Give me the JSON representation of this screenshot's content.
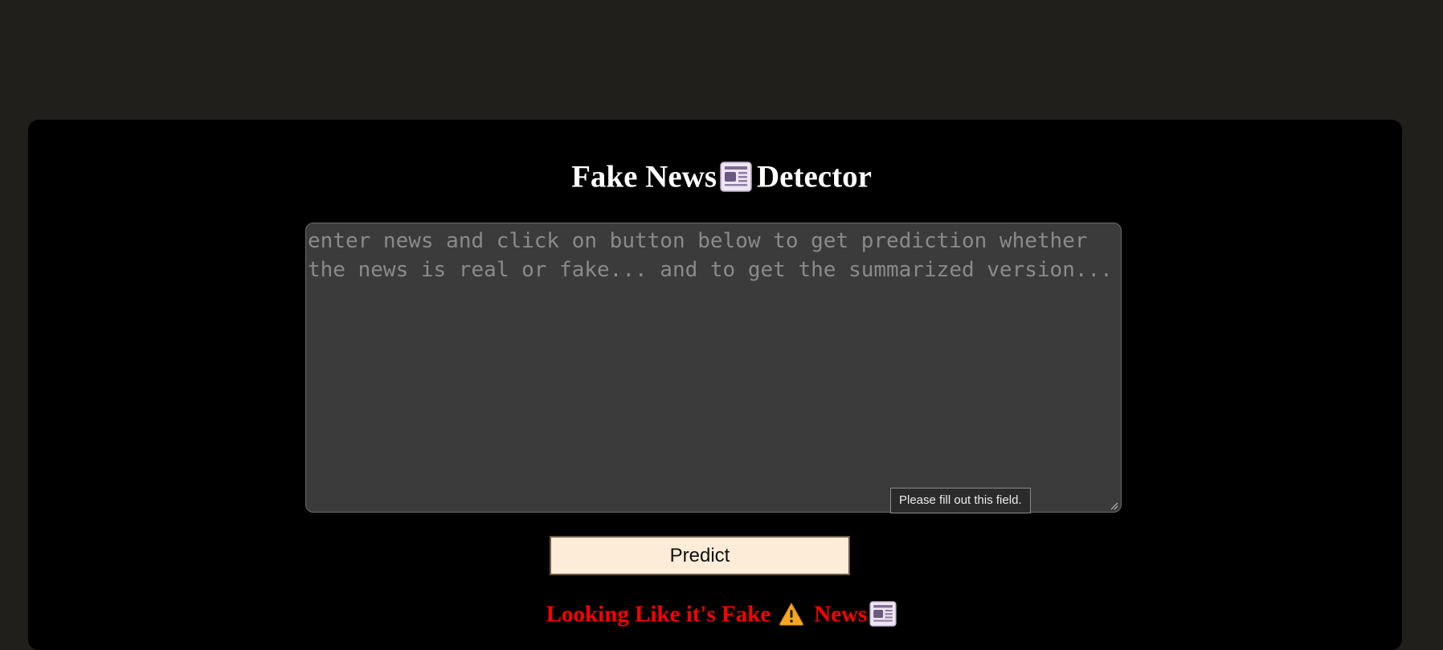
{
  "app": {
    "title_part1": "Fake News",
    "title_part2": "Detector",
    "title_icon": "newspaper-icon"
  },
  "input": {
    "value": "",
    "placeholder": "enter news and click on button below to get prediction whether the news is real or fake... and to get the summarized version...",
    "validation_tooltip": "Please fill out this field."
  },
  "actions": {
    "predict_label": "Predict"
  },
  "result": {
    "text_part1": "Looking Like it's Fake",
    "text_part2": "News",
    "warning_icon": "warning-icon",
    "news_icon": "newspaper-icon",
    "color": "#ff0000"
  },
  "colors": {
    "page_background": "#201f1b",
    "card_background": "#000000",
    "textarea_background": "#3b3b3b",
    "button_background": "#fdecd7"
  }
}
